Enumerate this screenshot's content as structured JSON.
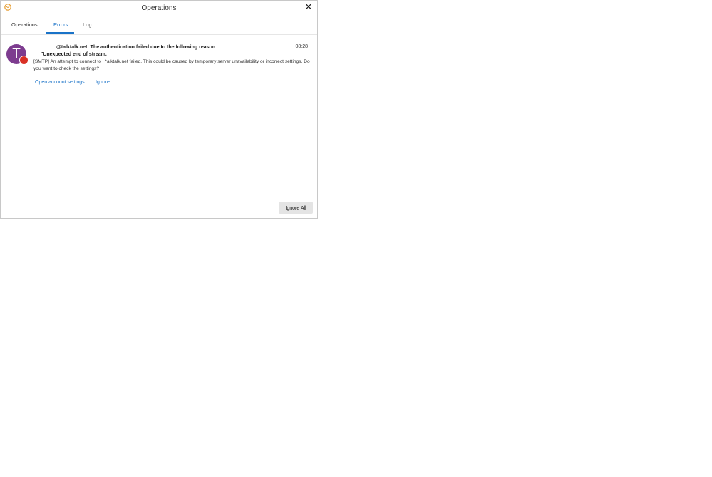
{
  "window": {
    "title": "Operations",
    "close_glyph": "✕",
    "app_icon": "mail-icon",
    "accent_color": "#1a73c8"
  },
  "tabs": [
    {
      "label": "Operations",
      "active": false
    },
    {
      "label": "Errors",
      "active": true
    },
    {
      "label": "Log",
      "active": false
    }
  ],
  "errors": [
    {
      "avatar_letter": "T",
      "avatar_color": "#7d3c8f",
      "badge_icon": "warning-icon",
      "badge_glyph": "!",
      "title_line1": "@talktalk.net: The authentication failed due to the following reason:",
      "title_line2": "\"Unexpected end of stream.",
      "time": "08:28",
      "body": "[SMTP] An attempt to connect to              ,  *alktalk.net failed. This could be caused by temporary server unavailability or incorrect settings. Do you want to check the settings?",
      "actions": {
        "open_settings": "Open account settings",
        "ignore": "Ignore"
      }
    }
  ],
  "footer": {
    "ignore_all": "Ignore All"
  }
}
